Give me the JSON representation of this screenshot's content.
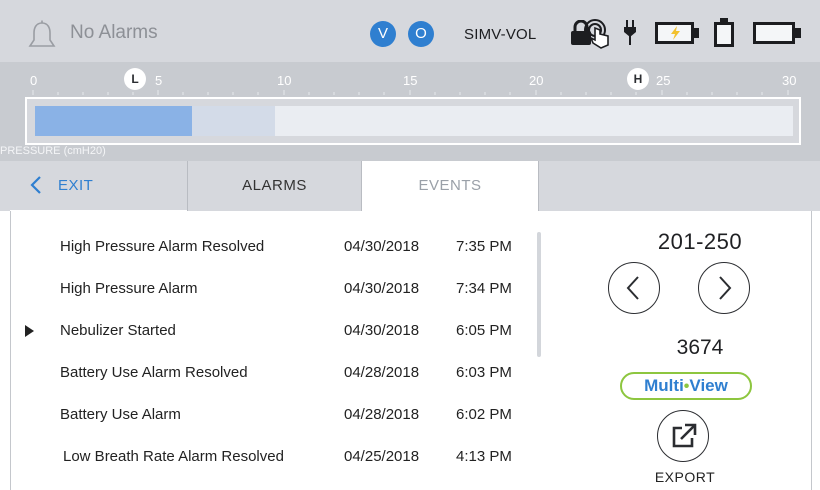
{
  "status_bar": {
    "alarm_text": "No Alarms",
    "mode_badges": [
      "V",
      "O"
    ],
    "mode": "SIMV-VOL",
    "icons": [
      "bell-icon",
      "lock-icon",
      "touch-lock-icon",
      "ac-plug-icon",
      "battery-charging-icon",
      "battery-portrait-icon",
      "battery-full-icon"
    ],
    "colors": {
      "badge": "#2f7fd0",
      "bar_bg": "#d6d8dd"
    }
  },
  "gauge": {
    "ticks": [
      "0",
      "5",
      "10",
      "15",
      "20",
      "25",
      "30"
    ],
    "low_marker": "L",
    "high_marker": "H",
    "label": "PRESSURE (cmH20)",
    "scale_max": 30,
    "low_limit": 4,
    "high_limit": 24,
    "current_value": 6.2,
    "peak_value": 9.5
  },
  "tabs": {
    "exit": "EXIT",
    "alarms": "ALARMS",
    "events": "EVENTS",
    "active": "EVENTS"
  },
  "events": [
    {
      "desc": "High Pressure Alarm Resolved",
      "date": "04/30/2018",
      "time": "7:35 PM",
      "selected": false
    },
    {
      "desc": "High Pressure Alarm",
      "date": "04/30/2018",
      "time": "7:34 PM",
      "selected": false
    },
    {
      "desc": "Nebulizer Started",
      "date": "04/30/2018",
      "time": "6:05 PM",
      "selected": true
    },
    {
      "desc": "Battery Use Alarm Resolved",
      "date": "04/28/2018",
      "time": "6:03 PM",
      "selected": false
    },
    {
      "desc": "Battery Use Alarm",
      "date": "04/28/2018",
      "time": "6:02 PM",
      "selected": false
    },
    {
      "desc": "Low Breath Rate Alarm Resolved",
      "date": "04/25/2018",
      "time": "4:13 PM",
      "selected": false
    }
  ],
  "pager": {
    "range": "201-250",
    "total": "3674",
    "multiview_left": "Multi",
    "multiview_sep": "•",
    "multiview_right": "View",
    "export_label": "EXPORT"
  }
}
